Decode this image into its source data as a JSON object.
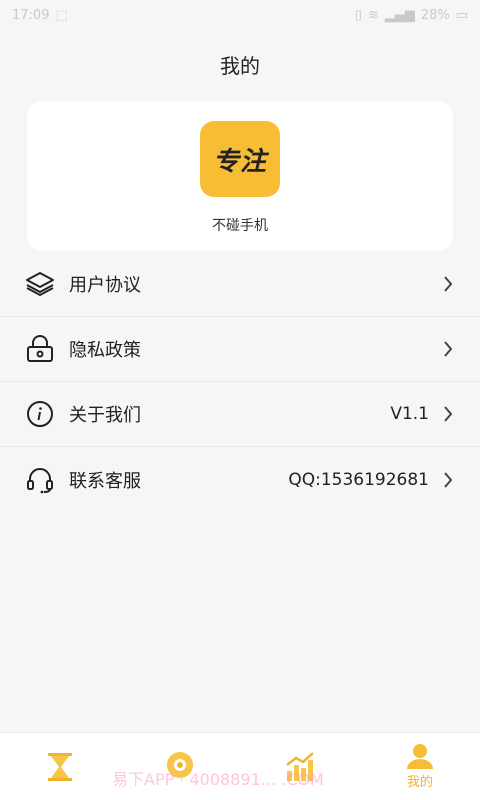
{
  "status_bar": {
    "time": "17:09",
    "battery": "28%"
  },
  "header": {
    "title": "我的"
  },
  "profile": {
    "logo_text": "专注",
    "app_name": "不碰手机"
  },
  "menu": [
    {
      "label": "用户协议",
      "value": "",
      "icon": "layers-icon"
    },
    {
      "label": "隐私政策",
      "value": "",
      "icon": "lock-icon"
    },
    {
      "label": "关于我们",
      "value": "V1.1",
      "icon": "info-icon"
    },
    {
      "label": "联系客服",
      "value": "QQ:1536192681",
      "icon": "headset-icon"
    }
  ],
  "tabs": [
    {
      "label": "",
      "icon": "hourglass-icon",
      "active": false
    },
    {
      "label": "",
      "icon": "focus-icon",
      "active": false
    },
    {
      "label": "",
      "icon": "chart-icon",
      "active": false
    },
    {
      "label": "我的",
      "icon": "user-icon",
      "active": true
    }
  ],
  "watermark": "易下APP · 4008891... .COM",
  "colors": {
    "accent": "#f7bd35",
    "background": "#f6f6f6",
    "card": "#ffffff"
  }
}
